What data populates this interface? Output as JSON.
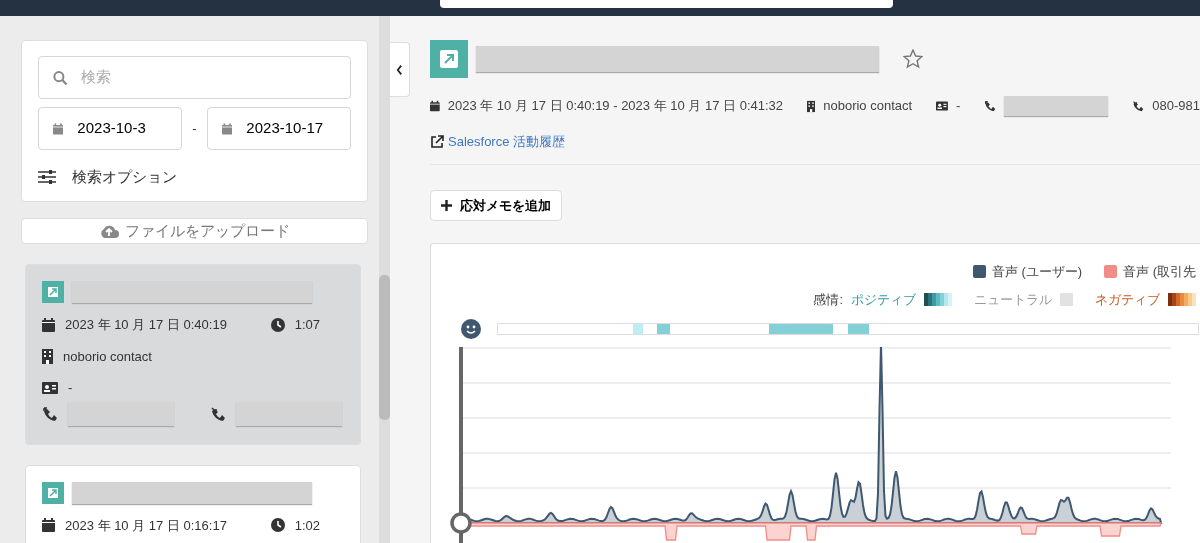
{
  "sidebar": {
    "search": {
      "placeholder": "検索"
    },
    "date_from": "2023-10-3",
    "date_separator": "-",
    "date_to": "2023-10-17",
    "search_options": "検索オプション",
    "upload_button": "ファイルをアップロード",
    "calls": [
      {
        "selected": true,
        "datetime": "2023 年 10 月 17 日 0:40:19",
        "duration": "1:07",
        "company": "noborio contact",
        "contact": "-"
      },
      {
        "selected": false,
        "datetime": "2023 年 10 月 17 日 0:16:17",
        "duration": "1:02"
      }
    ]
  },
  "detail": {
    "starred": false,
    "datetime_range": "2023 年 10 月 17 日 0:40:19 - 2023 年 10 月 17 日 0:41:32",
    "company": "noborio contact",
    "contact": "-",
    "phone_to": "080-981",
    "salesforce_link": "Salesforce 活動履歴",
    "add_memo_button": "応対メモを追加",
    "chart": {
      "legend": [
        {
          "label": "音声 (ユーザー)",
          "color": "#3f586f"
        },
        {
          "label": "音声 (取引先",
          "color": "#f28c86"
        }
      ],
      "sentiment_label": "感情:",
      "positive": "ポジティブ",
      "neutral": "ニュートラル",
      "negative": "ネガティブ"
    }
  }
}
